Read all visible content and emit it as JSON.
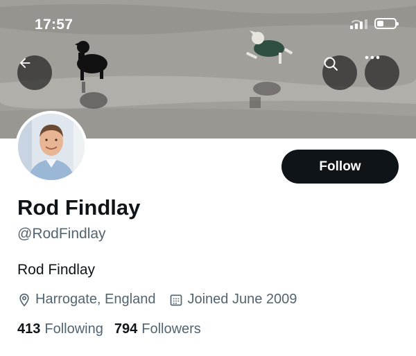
{
  "status_bar": {
    "time": "17:57",
    "icons": [
      "signal-icon",
      "wifi-icon",
      "battery-icon"
    ]
  },
  "banner": {
    "description_icons": [
      "back-arrow-icon",
      "search-icon",
      "more-icon"
    ]
  },
  "profile": {
    "display_name": "Rod Findlay",
    "handle": "@RodFindlay",
    "bio": "Rod Findlay",
    "location": "Harrogate, England",
    "joined": "Joined June 2009",
    "following_count": "413",
    "following_label": "Following",
    "followers_count": "794",
    "followers_label": "Followers"
  },
  "actions": {
    "follow_label": "Follow"
  },
  "colors": {
    "primary_text": "#0f1419",
    "secondary_text": "#536471",
    "follow_button": "#0f1419"
  }
}
